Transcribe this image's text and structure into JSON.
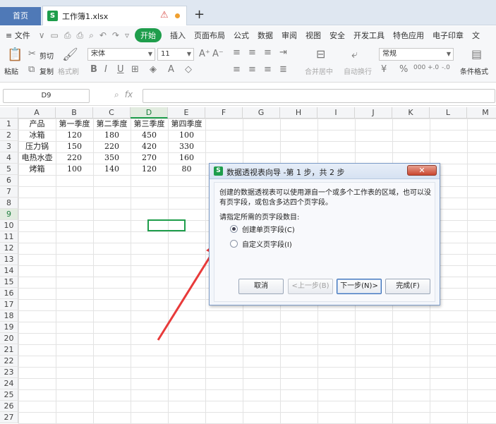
{
  "titlebar": {
    "home_tab": "首页",
    "file_tab": "工作簿1.xlsx",
    "app_logo": "S",
    "new_tab": "+"
  },
  "menubar": {
    "file": "≡ 文件",
    "items": [
      "开始",
      "插入",
      "页面布局",
      "公式",
      "数据",
      "审阅",
      "视图",
      "安全",
      "开发工具",
      "特色应用",
      "电子印章",
      "文"
    ]
  },
  "ribbon": {
    "paste": "粘贴",
    "cut": "剪切",
    "copy": "复制",
    "format_painter": "格式刷",
    "font_name": "宋体",
    "font_size": "11",
    "merge_center": "合并居中",
    "wrap_text": "自动换行",
    "number_format": "常规",
    "conditional_format": "条件格式"
  },
  "formula_bar": {
    "cell_ref": "D9",
    "fx": "fx",
    "value": ""
  },
  "grid": {
    "columns": [
      "A",
      "B",
      "C",
      "D",
      "E",
      "F",
      "G",
      "H",
      "I",
      "J",
      "K",
      "L",
      "M"
    ],
    "selected_column": "D",
    "selected_row": "9",
    "rows": [
      "1",
      "2",
      "3",
      "4",
      "5",
      "6",
      "7",
      "8",
      "9",
      "10",
      "11",
      "12",
      "13",
      "14",
      "15",
      "16",
      "17",
      "18",
      "19",
      "20",
      "21",
      "22",
      "23",
      "24",
      "25",
      "26",
      "27"
    ],
    "header_row": [
      "产品",
      "第一季度",
      "第二季度",
      "第三季度",
      "第四季度"
    ],
    "data_rows": [
      [
        "冰箱",
        "120",
        "180",
        "450",
        "100"
      ],
      [
        "压力锅",
        "150",
        "220",
        "420",
        "330"
      ],
      [
        "电热水壶",
        "220",
        "350",
        "270",
        "160"
      ],
      [
        "烤箱",
        "100",
        "140",
        "120",
        "80"
      ]
    ]
  },
  "dialog": {
    "logo": "S",
    "title": "数据透视表向导 -第 1 步，共 2 步",
    "close": "✕",
    "description": "创建的数据透视表可以使用源自一个或多个工作表的区域，也可以没有页字段，或包含多达四个页字段。",
    "prompt": "请指定所需的页字段数目:",
    "option_single": "创建单页字段(C)",
    "option_custom": "自定义页字段(I)",
    "btn_cancel": "取消",
    "btn_back": "<上一步(B)",
    "btn_next": "下一步(N)>",
    "btn_finish": "完成(F)"
  },
  "colors": {
    "accent_green": "#1e9d4b",
    "arrow_red": "#e83a3a"
  }
}
